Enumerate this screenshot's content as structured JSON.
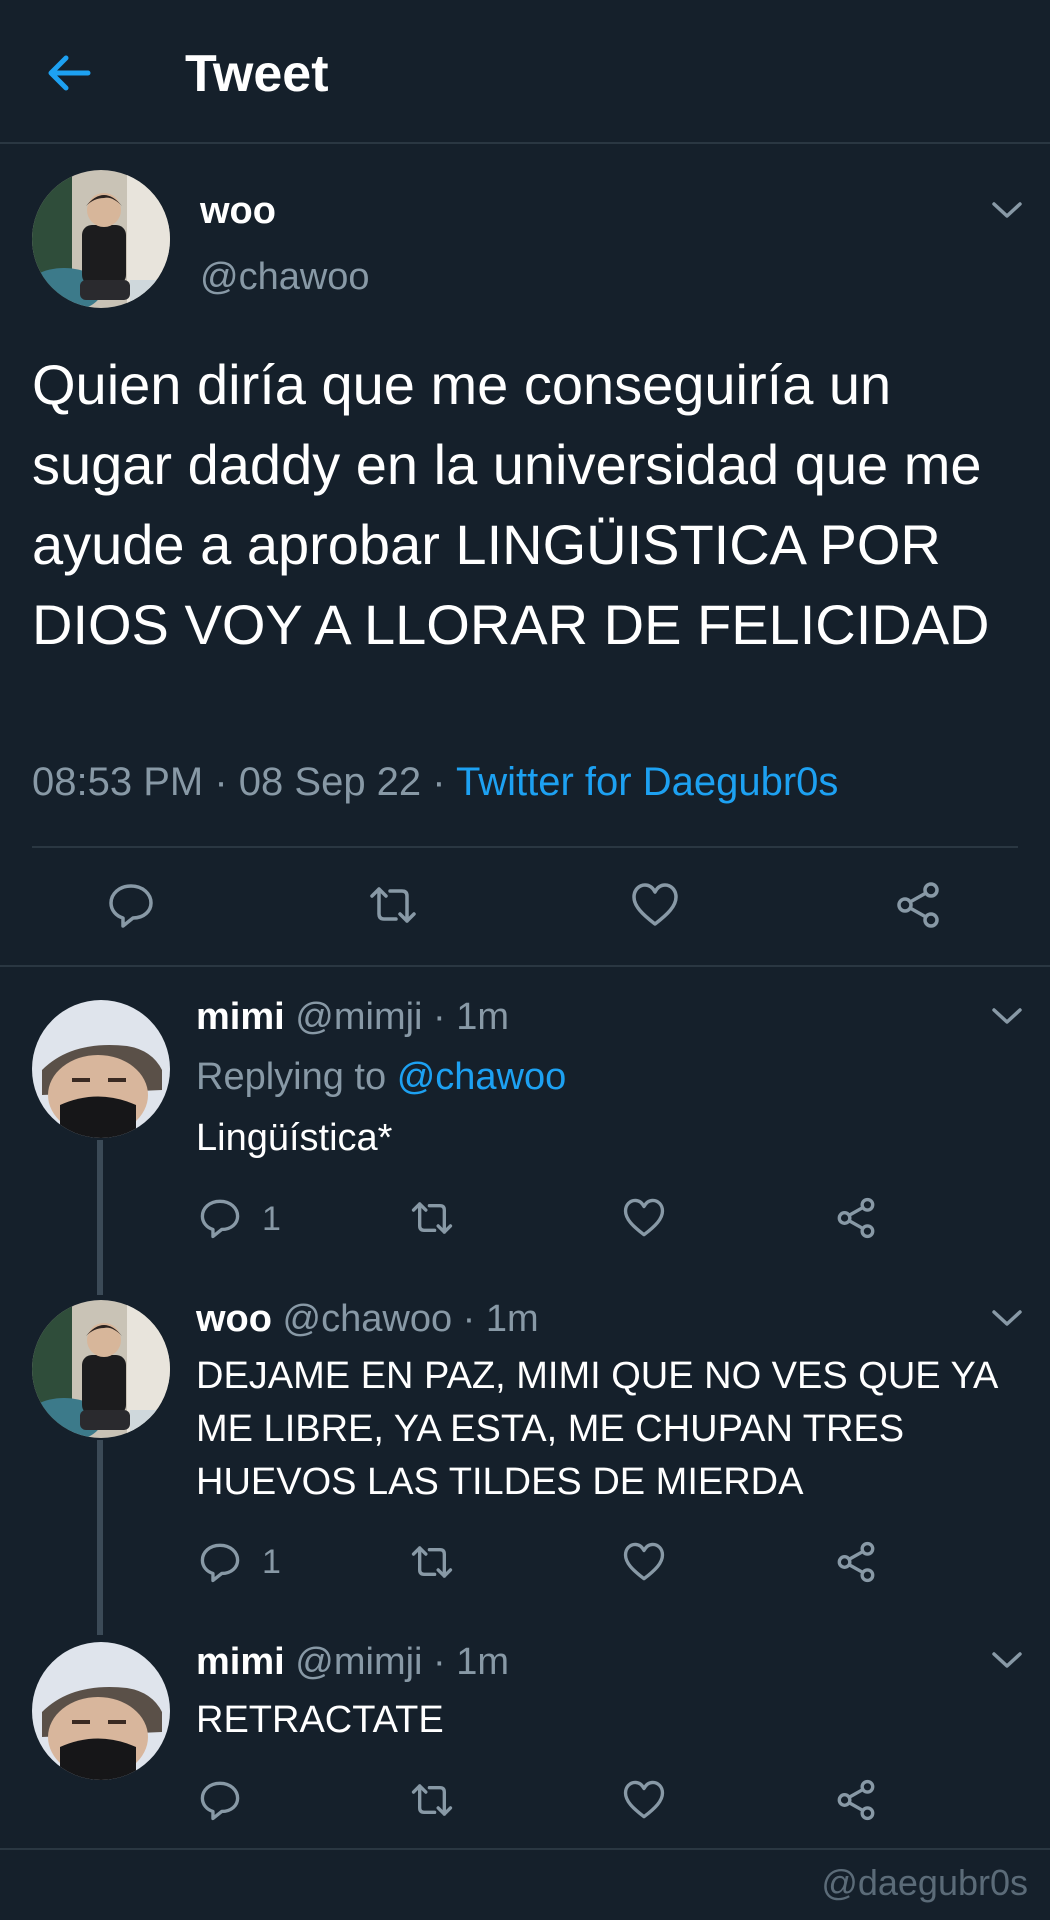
{
  "header": {
    "title": "Tweet"
  },
  "main_tweet": {
    "name": "woo",
    "handle": "@chawoo",
    "text": "Quien diría que me conseguiría un sugar daddy en la universidad que me ayude a aprobar LINGÜISTICA POR DIOS VOY A LLORAR DE FELICIDAD",
    "time": "08:53 PM",
    "date": "08 Sep 22",
    "source": "Twitter for Daegubr0s"
  },
  "replies": [
    {
      "name": "mimi",
      "handle": "@mimji",
      "age": "1m",
      "replying_label": "Replying to",
      "replying_handle": "@chawoo",
      "text": "Lingüística*",
      "reply_count": "1"
    },
    {
      "name": "woo",
      "handle": "@chawoo",
      "age": "1m",
      "text": "DEJAME EN PAZ, MIMI QUE NO VES QUE YA ME LIBRE, YA ESTA, ME CHUPAN TRES HUEVOS LAS TILDES DE MIERDA",
      "reply_count": "1"
    },
    {
      "name": "mimi",
      "handle": "@mimji",
      "age": "1m",
      "text": "RETRACTATE",
      "reply_count": ""
    }
  ],
  "watermark": "@daegubr0s",
  "colors": {
    "background": "#15202b",
    "accent": "#1da1f2",
    "secondary_text": "#8899a6",
    "divider": "#2a3742"
  },
  "icons": [
    "back-arrow-icon",
    "chevron-down-icon",
    "reply-icon",
    "retweet-icon",
    "like-icon",
    "share-icon"
  ]
}
